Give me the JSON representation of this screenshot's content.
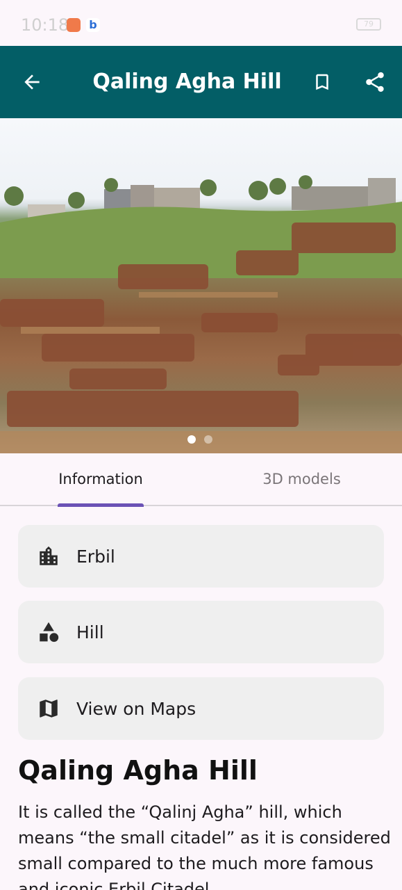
{
  "status_bar": {
    "time": "10:18",
    "battery": "79"
  },
  "app_bar": {
    "title": "Qaling Agha Hill"
  },
  "carousel": {
    "image_alt": "Qaling Agha Hill excavation site",
    "active_index": 1,
    "count": 2
  },
  "tabs": [
    {
      "label": "Information",
      "selected": true
    },
    {
      "label": "3D models",
      "selected": false
    }
  ],
  "info": [
    {
      "icon": "city-icon",
      "label": "Erbil"
    },
    {
      "icon": "shapes-icon",
      "label": "Hill"
    },
    {
      "icon": "map-icon",
      "label": "View on Maps"
    }
  ],
  "description": {
    "title": "Qaling Agha Hill",
    "body": "It is called the “Qalinj Agha” hill, which means “the small citadel” as it is considered small compared to the much more famous and iconic Erbil Citadel."
  },
  "colors": {
    "app_bar": "#035e66",
    "tab_indicator": "#6b52b5",
    "card_bg": "#efefef",
    "background": "#fcf6fb"
  }
}
